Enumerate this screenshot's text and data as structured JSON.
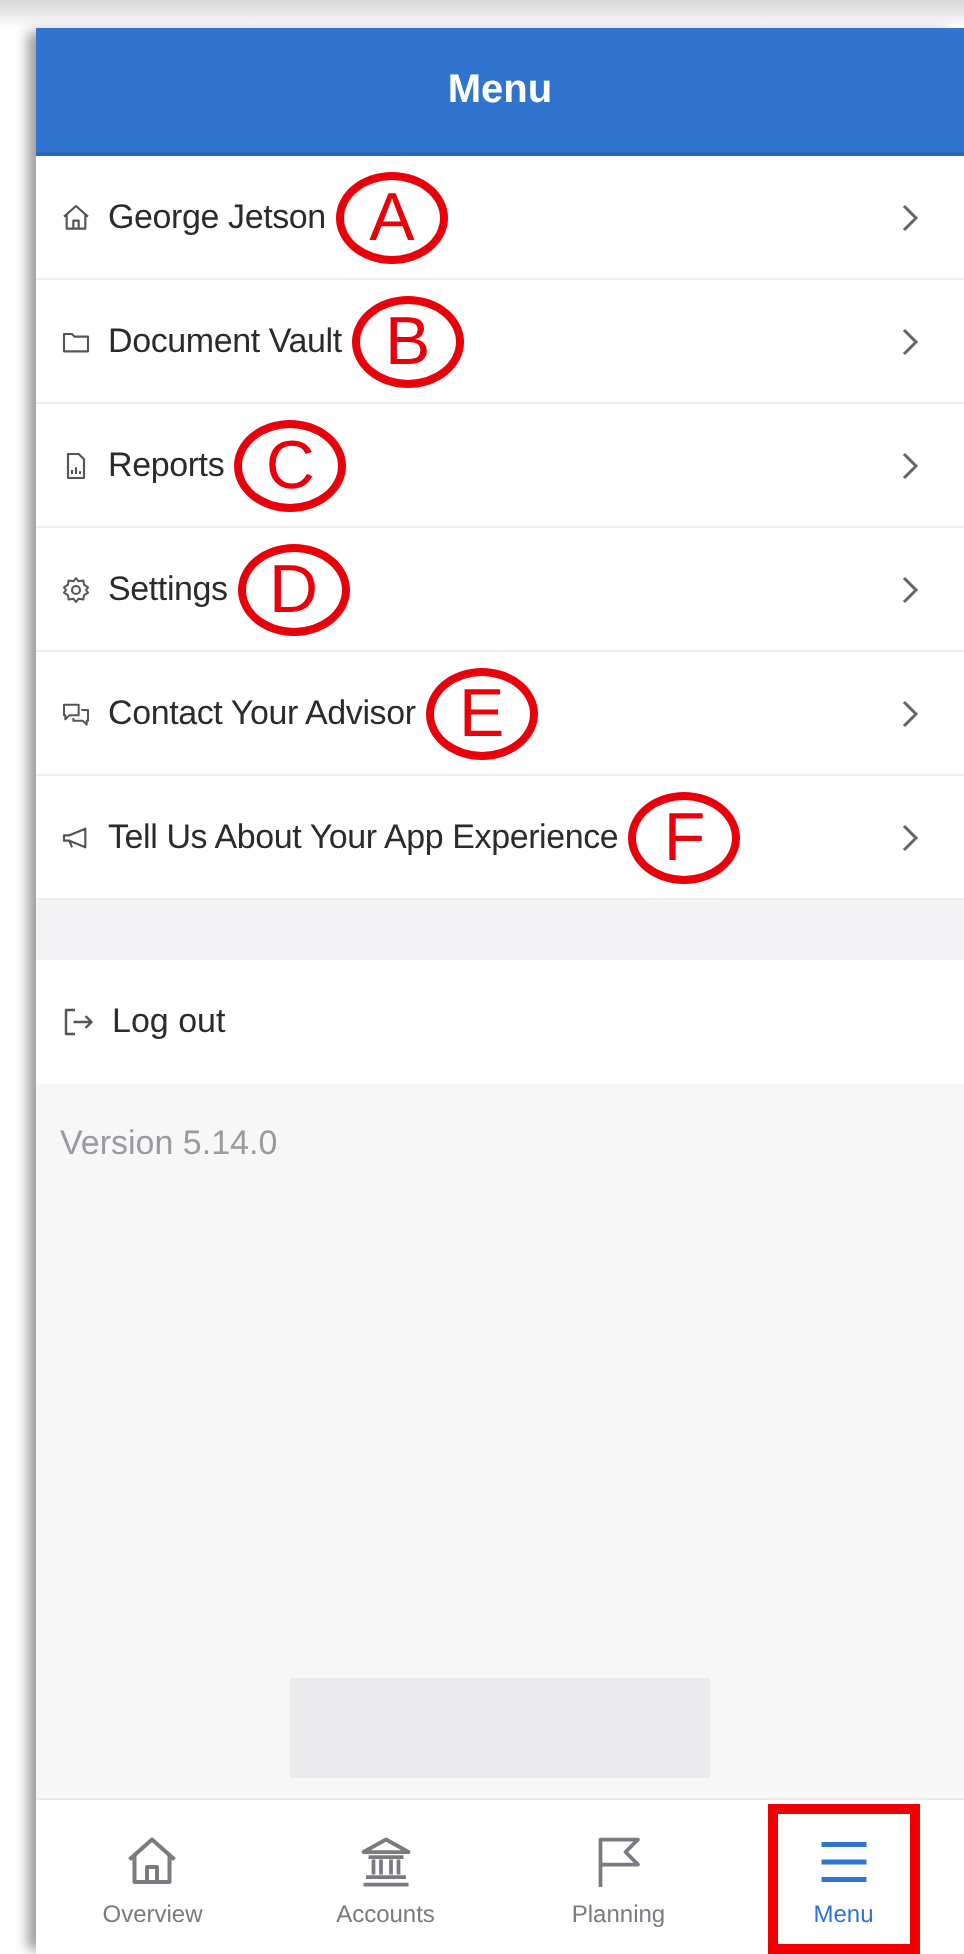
{
  "header": {
    "title": "Menu"
  },
  "menu_items": [
    {
      "label": "George Jetson",
      "callout": "A"
    },
    {
      "label": "Document Vault",
      "callout": "B"
    },
    {
      "label": "Reports",
      "callout": "C"
    },
    {
      "label": "Settings",
      "callout": "D"
    },
    {
      "label": "Contact Your Advisor",
      "callout": "E"
    },
    {
      "label": "Tell Us About Your App Experience",
      "callout": "F"
    }
  ],
  "logout": {
    "label": "Log out"
  },
  "version": "Version 5.14.0",
  "tab_bar": [
    {
      "label": "Overview",
      "selected": false,
      "highlighted": false
    },
    {
      "label": "Accounts",
      "selected": false,
      "highlighted": false
    },
    {
      "label": "Planning",
      "selected": false,
      "highlighted": false
    },
    {
      "label": "Menu",
      "selected": true,
      "highlighted": true
    }
  ]
}
